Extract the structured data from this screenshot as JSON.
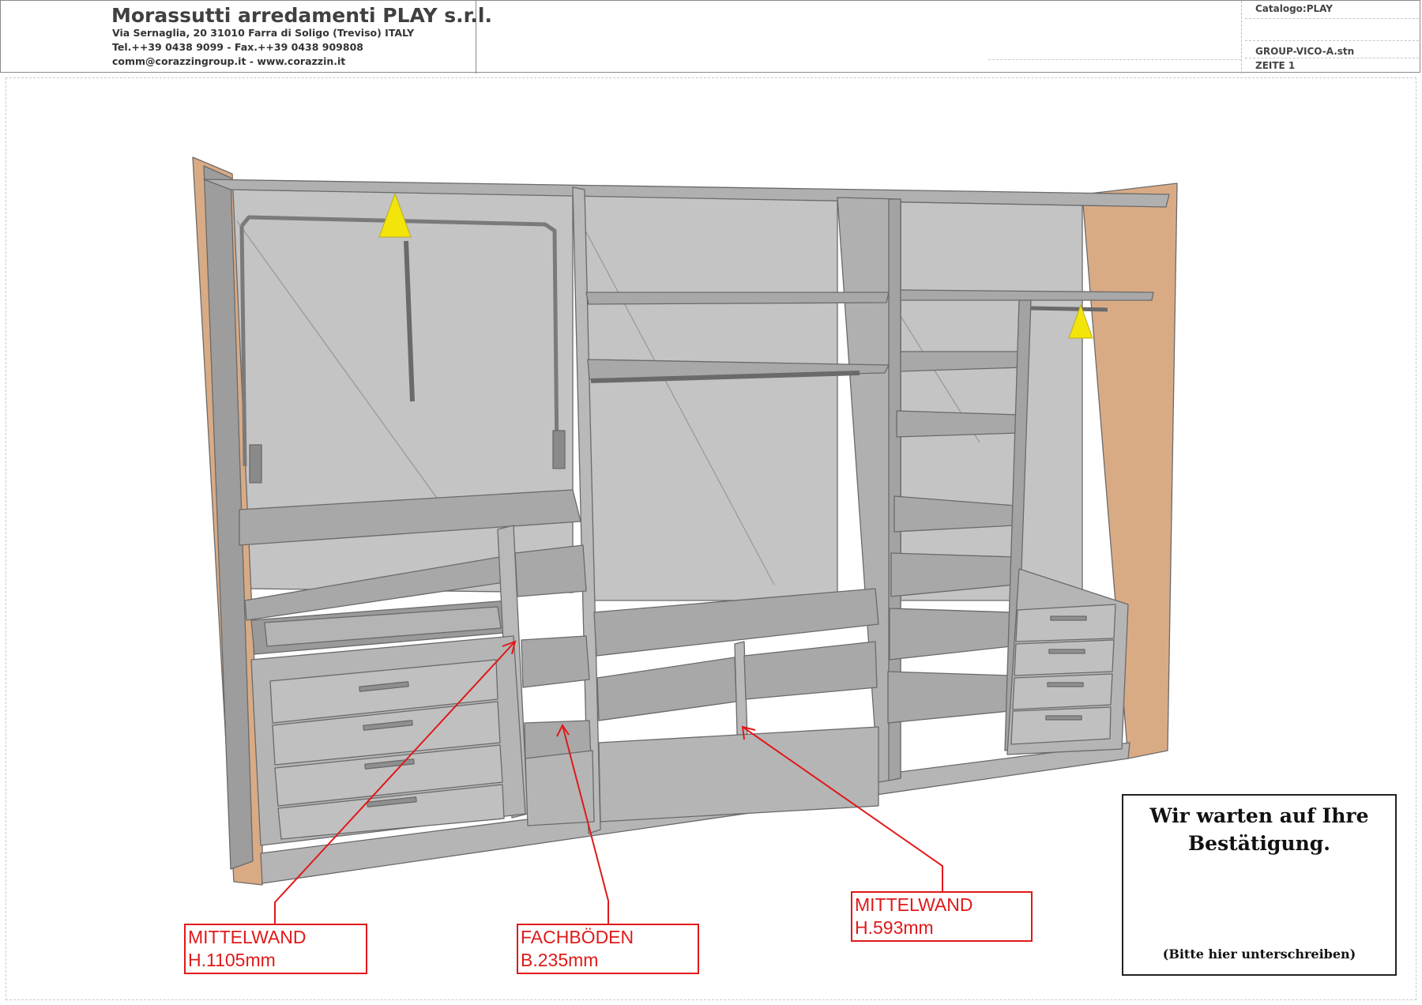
{
  "header": {
    "company": "Morassutti arredamenti PLAY s.r.l.",
    "address": "Via Sernaglia, 20 31010 Farra di Soligo (Treviso) ITALY",
    "phone": "Tel.++39 0438 9099 - Fax.++39 0438 909808",
    "contact": "comm@corazzingroup.it - www.corazzin.it",
    "catalog": "Catalogo:PLAY",
    "file": "GROUP-VICO-A.stn",
    "page": "ZEITE 1"
  },
  "annotations": [
    {
      "id": "mittelwand-1",
      "line1": "MITTELWAND",
      "line2": "H.1105mm"
    },
    {
      "id": "fachboeden",
      "line1": "FACHBÖDEN",
      "line2": "B.235mm"
    },
    {
      "id": "mittelwand-2",
      "line1": "MITTELWAND",
      "line2": "H.593mm"
    }
  ],
  "signature": {
    "title": "Wir warten auf Ihre Bestätigung.",
    "note": "(Bitte hier unterschreiben)"
  },
  "colors": {
    "panel": "#b9b9b9",
    "back_panel": "#c4c4c4",
    "shelf": "#a6a6a6",
    "side_panel": "#d9ab85",
    "annotation": "#e01919",
    "marker": "#f3e40a"
  }
}
